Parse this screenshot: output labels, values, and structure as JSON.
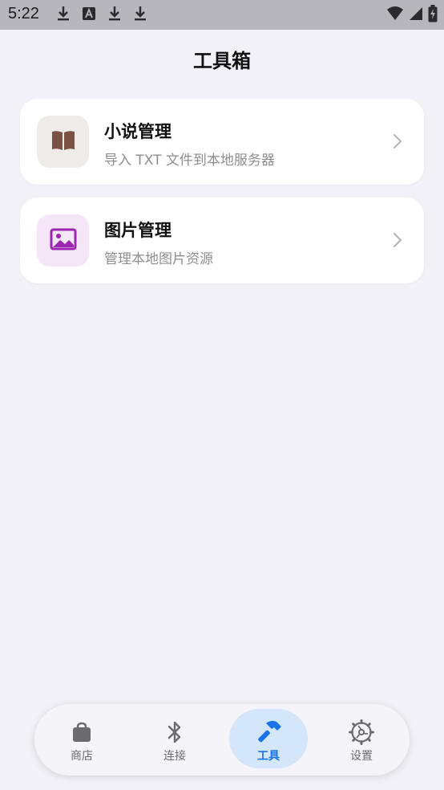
{
  "status_bar": {
    "time": "5:22",
    "left_icons": [
      "download-icon",
      "font-app-icon",
      "download-icon",
      "download-icon"
    ],
    "right_icons": [
      "wifi-icon",
      "signal-icon",
      "battery-charging-icon"
    ]
  },
  "header": {
    "title": "工具箱"
  },
  "tools": [
    {
      "title": "小说管理",
      "subtitle": "导入 TXT 文件到本地服务器",
      "icon": "book-icon",
      "icon_color": "#7a5244",
      "icon_bg": "#efebe8"
    },
    {
      "title": "图片管理",
      "subtitle": "管理本地图片资源",
      "icon": "image-icon",
      "icon_color": "#9b27b0",
      "icon_bg": "#f4e5f7"
    }
  ],
  "bottom_nav": {
    "items": [
      {
        "label": "商店",
        "icon": "shopping-bag-icon",
        "active": false
      },
      {
        "label": "连接",
        "icon": "bluetooth-icon",
        "active": false
      },
      {
        "label": "工具",
        "icon": "hammer-icon",
        "active": true
      },
      {
        "label": "设置",
        "icon": "settings-icon",
        "active": false
      }
    ],
    "active_color": "#1a73e8"
  }
}
